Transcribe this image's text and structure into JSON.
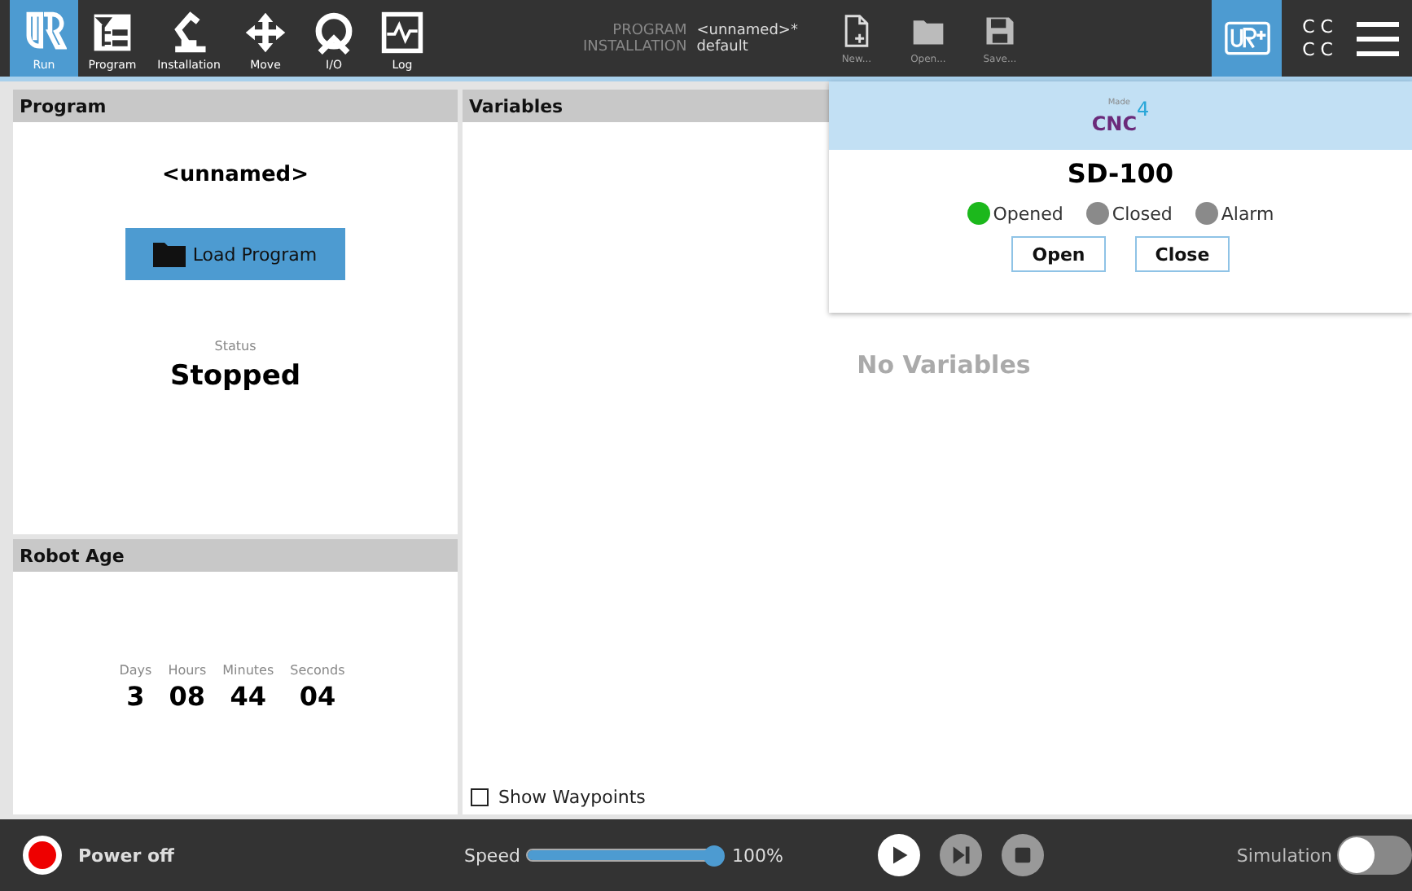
{
  "toolbar": {
    "tabs": [
      {
        "label": "Run",
        "selected": true
      },
      {
        "label": "Program",
        "selected": false
      },
      {
        "label": "Installation",
        "selected": false
      },
      {
        "label": "Move",
        "selected": false
      },
      {
        "label": "I/O",
        "selected": false
      },
      {
        "label": "Log",
        "selected": false
      }
    ],
    "program_label": "PROGRAM",
    "program_value": "<unnamed>*",
    "installation_label": "INSTALLATION",
    "installation_value": "default",
    "file_buttons": [
      "New...",
      "Open...",
      "Save..."
    ],
    "cc_rows": [
      "C C",
      "C C"
    ]
  },
  "program_panel": {
    "title": "Program",
    "name": "<unnamed>",
    "load_button": "Load Program",
    "status_label": "Status",
    "status": "Stopped"
  },
  "robot_age": {
    "title": "Robot Age",
    "units": [
      {
        "label": "Days",
        "value": "3"
      },
      {
        "label": "Hours",
        "value": "08"
      },
      {
        "label": "Minutes",
        "value": "44"
      },
      {
        "label": "Seconds",
        "value": "04"
      }
    ]
  },
  "variables": {
    "title": "Variables",
    "empty_text": "No Variables",
    "show_waypoints": {
      "label": "Show Waypoints",
      "checked": false
    }
  },
  "popup": {
    "logo_tagline": "Made",
    "logo_word": "CNC",
    "logo_sup": "4",
    "device": "SD-100",
    "indicators": [
      {
        "label": "Opened",
        "color": "#1cb81c"
      },
      {
        "label": "Closed",
        "color": "#8a8a8a"
      },
      {
        "label": "Alarm",
        "color": "#8a8a8a"
      }
    ],
    "buttons": [
      "Open",
      "Close"
    ]
  },
  "bottom_bar": {
    "power": "Power off",
    "speed_label": "Speed",
    "speed": {
      "level": 1.0
    },
    "speed_reading": "100%",
    "controls": [
      {
        "kind": "play",
        "disabled": false
      },
      {
        "kind": "step",
        "disabled": true
      },
      {
        "kind": "stop",
        "disabled": true
      }
    ],
    "simulation": {
      "label": "Simulation",
      "on": false
    }
  }
}
